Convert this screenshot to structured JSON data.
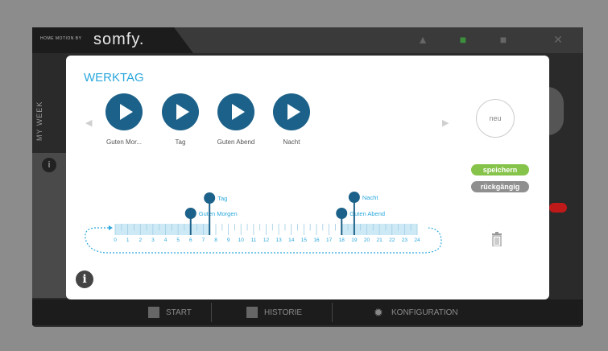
{
  "header": {
    "brand_small": "HOME MOTION BY",
    "brand": "somfy."
  },
  "side": {
    "label": "MY WEEK"
  },
  "modal": {
    "title": "WERKTAG",
    "scenes": [
      {
        "label": "Guten Mor..."
      },
      {
        "label": "Tag"
      },
      {
        "label": "Guten Abend"
      },
      {
        "label": "Nacht"
      }
    ],
    "new_button": "neu",
    "save_button": "speichern",
    "undo_button": "rückgängig",
    "timeline": {
      "hours": [
        "0",
        "1",
        "2",
        "3",
        "4",
        "5",
        "6",
        "7",
        "8",
        "9",
        "10",
        "11",
        "12",
        "13",
        "14",
        "15",
        "16",
        "17",
        "18",
        "19",
        "20",
        "21",
        "22",
        "23",
        "24"
      ],
      "events": [
        {
          "label": "Guten Morgen",
          "hour": 6.0
        },
        {
          "label": "Tag",
          "hour": 7.5
        },
        {
          "label": "Guten Abend",
          "hour": 18.0
        },
        {
          "label": "Nacht",
          "hour": 19.0
        }
      ]
    }
  },
  "bottom_nav": [
    {
      "label": "START",
      "icon": "home-icon"
    },
    {
      "label": "HISTORIE",
      "icon": "history-icon"
    },
    {
      "label": "KONFIGURATION",
      "icon": "gear-icon"
    }
  ],
  "colors": {
    "accent": "#2ba8dd",
    "play": "#1c6189",
    "save": "#86c34a",
    "undo": "#8f8f8f",
    "timeline_fill": "#cde9f6"
  }
}
